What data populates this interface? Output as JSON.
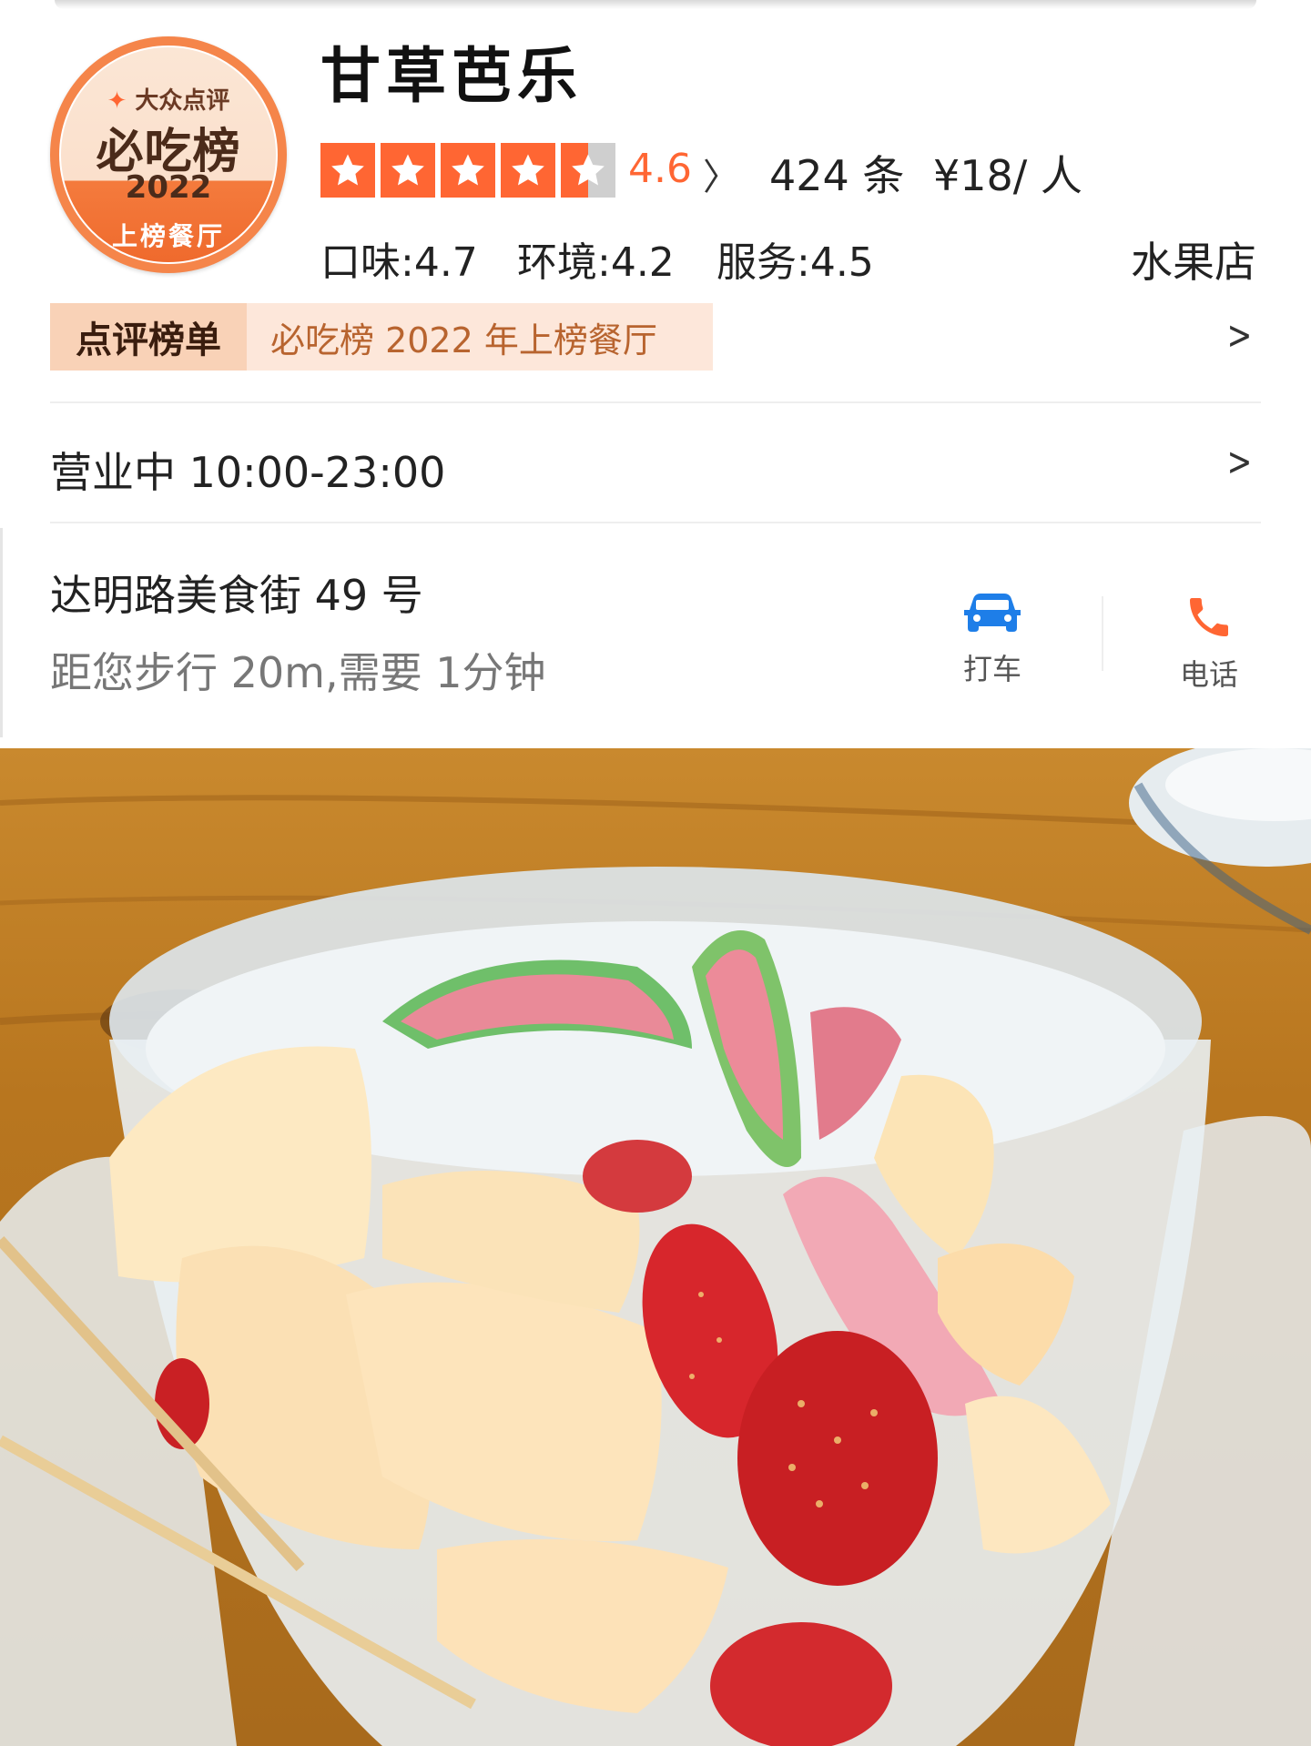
{
  "badge": {
    "brand": "大众点评",
    "title": "必吃榜",
    "year": "2022",
    "subtitle": "上榜餐厅"
  },
  "shop": {
    "name": "甘草芭乐",
    "rating": "4.6",
    "rating_stars": 4.6,
    "review_count": "424 条",
    "price": "¥18/ 人",
    "scores": {
      "taste": "口味:4.7",
      "environment": "环境:4.2",
      "service": "服务:4.5"
    },
    "category": "水果店"
  },
  "ranking": {
    "tag": "点评榜单",
    "text": "必吃榜 2022 年上榜餐厅"
  },
  "hours": {
    "text": "营业中 10:00-23:00"
  },
  "location": {
    "address": "达明路美食街 49 号",
    "distance": "距您步行 20m,需要 1分钟"
  },
  "actions": {
    "taxi": "打车",
    "phone": "电话"
  },
  "colors": {
    "accent": "#ff6633",
    "badge_orange": "#f47b3d",
    "taxi_blue": "#1e7ee8"
  },
  "icons": {
    "taxi": "car-icon",
    "phone": "phone-icon",
    "chevron": "chevron-right-icon",
    "star": "star-icon"
  }
}
